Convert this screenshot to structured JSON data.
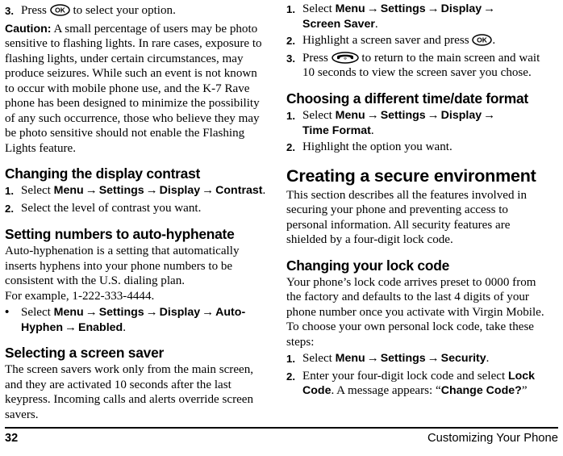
{
  "document": {
    "type": "phone-user-manual-page",
    "page_number": "32",
    "footer_chapter": "Customizing Your Phone"
  },
  "icons": {
    "ok_key": "ok-key-icon",
    "end_key": "end-call-key-icon",
    "ok_key_label": "OK"
  },
  "left_column": {
    "step3": {
      "marker": "3.",
      "text_before": "Press",
      "text_after": "to select your option."
    },
    "caution": {
      "label": "Caution:",
      "text": " A small percentage of users may be photo sensitive to flashing lights. In rare cases, exposure to flashing lights, under certain circumstances, may produce seizures. While such an event is not known to occur with mobile phone use, and the K-7 Rave phone has been designed to minimize the possibility of any such occurrence, those who believe they may be photo sensitive should not enable the Flashing Lights feature."
    },
    "contrast": {
      "heading": "Changing the display contrast",
      "steps": [
        {
          "marker": "1.",
          "prefix": "Select ",
          "path": [
            "Menu",
            "Settings",
            "Display",
            "Contrast"
          ],
          "suffix": "."
        },
        {
          "marker": "2.",
          "prefix": "Select the level of contrast you want.",
          "path": [],
          "suffix": ""
        }
      ]
    },
    "autohyphen": {
      "heading": "Setting numbers to auto-hyphenate",
      "body": "Auto-hyphenation is a setting that automatically inserts hyphens into your phone numbers to be consistent with the U.S. dialing plan.",
      "example": "For example, 1-222-333-4444.",
      "bullet": {
        "marker": "•",
        "prefix": "Select ",
        "path": [
          "Menu",
          "Settings",
          "Display",
          "Auto-Hyphen",
          "Enabled"
        ],
        "suffix": "."
      }
    },
    "screensaver": {
      "heading": "Selecting a screen saver",
      "body": "The screen savers work only from the main screen, and they are activated 10 seconds after the last keypress. Incoming calls and alerts override screen savers."
    }
  },
  "right_column": {
    "screensaver_steps": [
      {
        "marker": "1.",
        "prefix": "Select ",
        "path": [
          "Menu",
          "Settings",
          "Display",
          "Screen Saver"
        ],
        "suffix": "."
      },
      {
        "marker": "2.",
        "prefix": "Highlight a screen saver and press ",
        "icon": "ok-key-icon",
        "suffix": "."
      },
      {
        "marker": "3.",
        "prefix": "Press ",
        "icon": "end-call-key-icon",
        "suffix": " to return to the main screen and wait 10 seconds to view the screen saver you chose."
      }
    ],
    "timedate": {
      "heading": "Choosing a different time/date format",
      "steps": [
        {
          "marker": "1.",
          "prefix": "Select ",
          "path": [
            "Menu",
            "Settings",
            "Display",
            "Time Format"
          ],
          "suffix": "."
        },
        {
          "marker": "2.",
          "prefix": "Highlight the option you want.",
          "path": [],
          "suffix": ""
        }
      ]
    },
    "secure": {
      "heading": "Creating a secure environment",
      "body": "This section describes all the features involved in securing your phone and preventing access to personal information. All security features are shielded by a four-digit lock code."
    },
    "lockcode": {
      "heading": "Changing your lock code",
      "body": "Your phone’s lock code arrives preset to 0000 from the factory and defaults to the last 4 digits of your phone number once you activate with Virgin Mobile. To choose your own personal lock code, take these steps:",
      "steps": [
        {
          "marker": "1.",
          "prefix": "Select ",
          "path": [
            "Menu",
            "Settings",
            "Security"
          ],
          "suffix": "."
        },
        {
          "marker": "2.",
          "prefix": "Enter your four-digit lock code and select ",
          "bold1": "Lock Code",
          "mid": ". A message appears: “",
          "bold2": "Change Code?",
          "suffix": "”"
        }
      ]
    }
  }
}
